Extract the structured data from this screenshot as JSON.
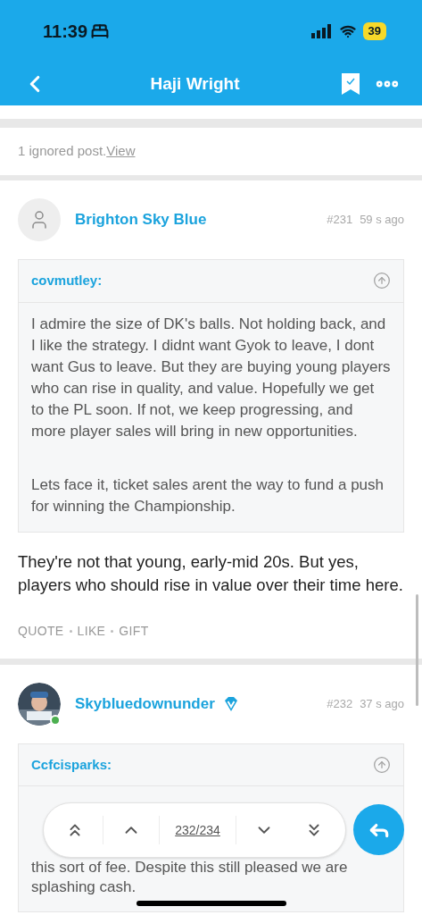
{
  "status_bar": {
    "time": "11:39",
    "battery": "39"
  },
  "header": {
    "title": "Haji Wright"
  },
  "ignored": {
    "text": "1 ignored post.",
    "link": "View"
  },
  "posts": [
    {
      "author": "Brighton Sky Blue",
      "verified": false,
      "online": false,
      "kind": "placeholder",
      "number": "#231",
      "time": "59 s ago",
      "quote": {
        "author": "covmutley:",
        "paragraphs": [
          "I admire the size of DK's balls. Not holding back, and I like the strategy. I didnt want Gyok to leave, I dont want Gus to leave. But they are buying young players who can rise in quality, and value. Hopefully we get to the PL soon. If not, we keep progressing, and more player sales will bring in new opportunities.",
          "Lets face it, ticket sales arent the way to fund a push for winning the Championship."
        ]
      },
      "body": "They're not that young, early-mid 20s. But yes, players who should rise in value over their time here.",
      "actions": [
        "QUOTE",
        "LIKE",
        "GIFT"
      ]
    },
    {
      "author": "Skybluedownunder",
      "verified": true,
      "online": true,
      "kind": "picture",
      "number": "#232",
      "time": "37 s ago",
      "quote": {
        "author": "Ccfcisparks:",
        "paragraphs": [
          "this sort of fee. Despite this still pleased we are splashing cash."
        ]
      }
    }
  ],
  "pager": {
    "label": "232/234"
  }
}
